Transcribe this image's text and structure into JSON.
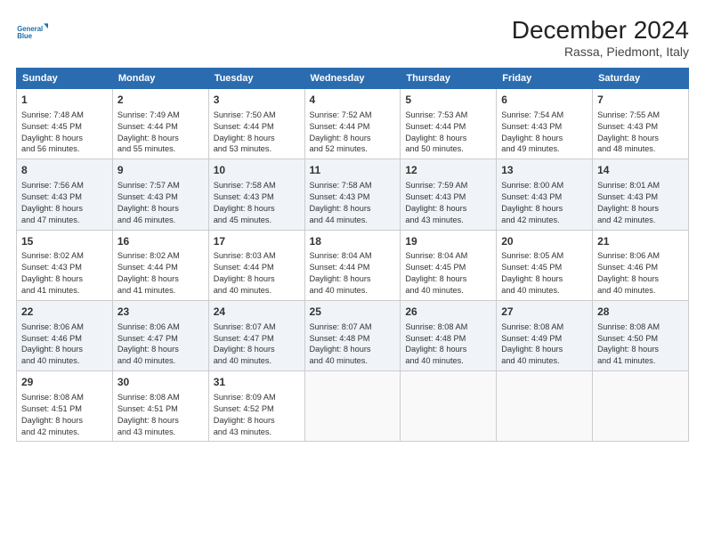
{
  "logo": {
    "line1": "General",
    "line2": "Blue"
  },
  "title": "December 2024",
  "subtitle": "Rassa, Piedmont, Italy",
  "days_header": [
    "Sunday",
    "Monday",
    "Tuesday",
    "Wednesday",
    "Thursday",
    "Friday",
    "Saturday"
  ],
  "weeks": [
    [
      {
        "day": "1",
        "lines": [
          "Sunrise: 7:48 AM",
          "Sunset: 4:45 PM",
          "Daylight: 8 hours",
          "and 56 minutes."
        ]
      },
      {
        "day": "2",
        "lines": [
          "Sunrise: 7:49 AM",
          "Sunset: 4:44 PM",
          "Daylight: 8 hours",
          "and 55 minutes."
        ]
      },
      {
        "day": "3",
        "lines": [
          "Sunrise: 7:50 AM",
          "Sunset: 4:44 PM",
          "Daylight: 8 hours",
          "and 53 minutes."
        ]
      },
      {
        "day": "4",
        "lines": [
          "Sunrise: 7:52 AM",
          "Sunset: 4:44 PM",
          "Daylight: 8 hours",
          "and 52 minutes."
        ]
      },
      {
        "day": "5",
        "lines": [
          "Sunrise: 7:53 AM",
          "Sunset: 4:44 PM",
          "Daylight: 8 hours",
          "and 50 minutes."
        ]
      },
      {
        "day": "6",
        "lines": [
          "Sunrise: 7:54 AM",
          "Sunset: 4:43 PM",
          "Daylight: 8 hours",
          "and 49 minutes."
        ]
      },
      {
        "day": "7",
        "lines": [
          "Sunrise: 7:55 AM",
          "Sunset: 4:43 PM",
          "Daylight: 8 hours",
          "and 48 minutes."
        ]
      }
    ],
    [
      {
        "day": "8",
        "lines": [
          "Sunrise: 7:56 AM",
          "Sunset: 4:43 PM",
          "Daylight: 8 hours",
          "and 47 minutes."
        ]
      },
      {
        "day": "9",
        "lines": [
          "Sunrise: 7:57 AM",
          "Sunset: 4:43 PM",
          "Daylight: 8 hours",
          "and 46 minutes."
        ]
      },
      {
        "day": "10",
        "lines": [
          "Sunrise: 7:58 AM",
          "Sunset: 4:43 PM",
          "Daylight: 8 hours",
          "and 45 minutes."
        ]
      },
      {
        "day": "11",
        "lines": [
          "Sunrise: 7:58 AM",
          "Sunset: 4:43 PM",
          "Daylight: 8 hours",
          "and 44 minutes."
        ]
      },
      {
        "day": "12",
        "lines": [
          "Sunrise: 7:59 AM",
          "Sunset: 4:43 PM",
          "Daylight: 8 hours",
          "and 43 minutes."
        ]
      },
      {
        "day": "13",
        "lines": [
          "Sunrise: 8:00 AM",
          "Sunset: 4:43 PM",
          "Daylight: 8 hours",
          "and 42 minutes."
        ]
      },
      {
        "day": "14",
        "lines": [
          "Sunrise: 8:01 AM",
          "Sunset: 4:43 PM",
          "Daylight: 8 hours",
          "and 42 minutes."
        ]
      }
    ],
    [
      {
        "day": "15",
        "lines": [
          "Sunrise: 8:02 AM",
          "Sunset: 4:43 PM",
          "Daylight: 8 hours",
          "and 41 minutes."
        ]
      },
      {
        "day": "16",
        "lines": [
          "Sunrise: 8:02 AM",
          "Sunset: 4:44 PM",
          "Daylight: 8 hours",
          "and 41 minutes."
        ]
      },
      {
        "day": "17",
        "lines": [
          "Sunrise: 8:03 AM",
          "Sunset: 4:44 PM",
          "Daylight: 8 hours",
          "and 40 minutes."
        ]
      },
      {
        "day": "18",
        "lines": [
          "Sunrise: 8:04 AM",
          "Sunset: 4:44 PM",
          "Daylight: 8 hours",
          "and 40 minutes."
        ]
      },
      {
        "day": "19",
        "lines": [
          "Sunrise: 8:04 AM",
          "Sunset: 4:45 PM",
          "Daylight: 8 hours",
          "and 40 minutes."
        ]
      },
      {
        "day": "20",
        "lines": [
          "Sunrise: 8:05 AM",
          "Sunset: 4:45 PM",
          "Daylight: 8 hours",
          "and 40 minutes."
        ]
      },
      {
        "day": "21",
        "lines": [
          "Sunrise: 8:06 AM",
          "Sunset: 4:46 PM",
          "Daylight: 8 hours",
          "and 40 minutes."
        ]
      }
    ],
    [
      {
        "day": "22",
        "lines": [
          "Sunrise: 8:06 AM",
          "Sunset: 4:46 PM",
          "Daylight: 8 hours",
          "and 40 minutes."
        ]
      },
      {
        "day": "23",
        "lines": [
          "Sunrise: 8:06 AM",
          "Sunset: 4:47 PM",
          "Daylight: 8 hours",
          "and 40 minutes."
        ]
      },
      {
        "day": "24",
        "lines": [
          "Sunrise: 8:07 AM",
          "Sunset: 4:47 PM",
          "Daylight: 8 hours",
          "and 40 minutes."
        ]
      },
      {
        "day": "25",
        "lines": [
          "Sunrise: 8:07 AM",
          "Sunset: 4:48 PM",
          "Daylight: 8 hours",
          "and 40 minutes."
        ]
      },
      {
        "day": "26",
        "lines": [
          "Sunrise: 8:08 AM",
          "Sunset: 4:48 PM",
          "Daylight: 8 hours",
          "and 40 minutes."
        ]
      },
      {
        "day": "27",
        "lines": [
          "Sunrise: 8:08 AM",
          "Sunset: 4:49 PM",
          "Daylight: 8 hours",
          "and 40 minutes."
        ]
      },
      {
        "day": "28",
        "lines": [
          "Sunrise: 8:08 AM",
          "Sunset: 4:50 PM",
          "Daylight: 8 hours",
          "and 41 minutes."
        ]
      }
    ],
    [
      {
        "day": "29",
        "lines": [
          "Sunrise: 8:08 AM",
          "Sunset: 4:51 PM",
          "Daylight: 8 hours",
          "and 42 minutes."
        ]
      },
      {
        "day": "30",
        "lines": [
          "Sunrise: 8:08 AM",
          "Sunset: 4:51 PM",
          "Daylight: 8 hours",
          "and 43 minutes."
        ]
      },
      {
        "day": "31",
        "lines": [
          "Sunrise: 8:09 AM",
          "Sunset: 4:52 PM",
          "Daylight: 8 hours",
          "and 43 minutes."
        ]
      },
      null,
      null,
      null,
      null
    ]
  ]
}
